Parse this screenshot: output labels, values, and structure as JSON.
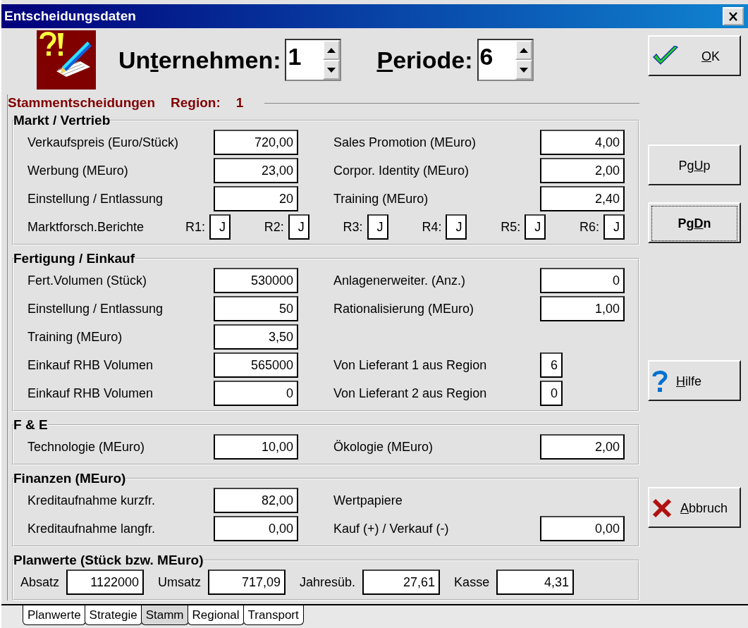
{
  "window": {
    "title": "Entscheidungsdaten"
  },
  "header": {
    "fields": [
      {
        "pre": "Un",
        "key": "t",
        "post": "ernehmen:",
        "value": "1"
      },
      {
        "key": "P",
        "post": "eriode:",
        "value": "6"
      }
    ]
  },
  "section": {
    "title": "Stammentscheidungen",
    "region_label": "Region:",
    "region": "1"
  },
  "groups": [
    {
      "title": "Markt / Vertrieb",
      "rows": [
        {
          "kind": "pair",
          "left": {
            "label": "Verkaufspreis (Euro/Stück)",
            "value": "720,00"
          },
          "right": {
            "label": "Sales Promotion (MEuro)",
            "value": "4,00"
          }
        },
        {
          "kind": "pair",
          "left": {
            "label": "Werbung (MEuro)",
            "value": "23,00"
          },
          "right": {
            "label": "Corpor. Identity (MEuro)",
            "value": "2,00"
          }
        },
        {
          "kind": "pair",
          "left": {
            "label": "Einstellung / Entlassung",
            "value": "20"
          },
          "right": {
            "label": "Training (MEuro)",
            "value": "2,40"
          }
        },
        {
          "kind": "reports",
          "label": "Marktforsch.Berichte",
          "items": [
            {
              "label": "R1:",
              "value": "J"
            },
            {
              "label": "R2:",
              "value": "J"
            },
            {
              "label": "R3:",
              "value": "J"
            },
            {
              "label": "R4:",
              "value": "J"
            },
            {
              "label": "R5:",
              "value": "J"
            },
            {
              "label": "R6:",
              "value": "J"
            }
          ]
        }
      ]
    },
    {
      "title": "Fertigung / Einkauf",
      "rows": [
        {
          "kind": "pair",
          "left": {
            "label": "Fert.Volumen (Stück)",
            "value": "530000"
          },
          "right": {
            "label": "Anlagenerweiter. (Anz.)",
            "value": "0"
          }
        },
        {
          "kind": "pair",
          "left": {
            "label": "Einstellung / Entlassung",
            "value": "50"
          },
          "right": {
            "label": "Rationalisierung (MEuro)",
            "value": "1,00"
          }
        },
        {
          "kind": "pair",
          "left": {
            "label": "Training  (MEuro)",
            "value": "3,50"
          }
        },
        {
          "kind": "pair",
          "left": {
            "label": "Einkauf  RHB Volumen",
            "value": "565000"
          },
          "right": {
            "label": "Von Lieferant 1 aus Region",
            "value": "6",
            "small": true
          }
        },
        {
          "kind": "pair",
          "left": {
            "label": "Einkauf  RHB Volumen",
            "value": "0"
          },
          "right": {
            "label": "Von Lieferant 2 aus Region",
            "value": "0",
            "small": true
          }
        }
      ]
    },
    {
      "title": "F & E",
      "rows": [
        {
          "kind": "pair",
          "left": {
            "label": "Technologie  (MEuro)",
            "value": "10,00"
          },
          "right": {
            "label": "Ökologie (MEuro)",
            "value": "2,00"
          }
        }
      ]
    },
    {
      "title": "Finanzen (MEuro)",
      "rows": [
        {
          "kind": "pair",
          "left": {
            "label": "Kreditaufnahme kurzfr.",
            "value": "82,00"
          },
          "right": {
            "label": "Wertpapiere"
          }
        },
        {
          "kind": "pair",
          "left": {
            "label": "Kreditaufnahme langfr.",
            "value": "0,00"
          },
          "right": {
            "label": "Kauf (+) / Verkauf (-)",
            "value": "0,00"
          }
        }
      ]
    }
  ],
  "plan": {
    "title": "Planwerte (Stück bzw. MEuro)",
    "items": [
      {
        "label": "Absatz",
        "value": "1122000"
      },
      {
        "label": "Umsatz",
        "value": "717,09"
      },
      {
        "label": "Jahresüb.",
        "value": "27,61"
      },
      {
        "label": "Kasse",
        "value": "4,31"
      }
    ]
  },
  "buttons": [
    {
      "kind": "ok",
      "key": "O",
      "post": "K",
      "focused": false
    },
    {
      "kind": "pgup",
      "pre": "Pg",
      "key": "U",
      "post": "p",
      "focused": false
    },
    {
      "kind": "pgdn",
      "pre": "Pg",
      "key": "D",
      "post": "n",
      "focused": true
    },
    {
      "kind": "help",
      "key": "H",
      "post": "ilfe",
      "focused": false
    },
    {
      "kind": "cancel",
      "key": "A",
      "post": "bbruch",
      "focused": false
    }
  ],
  "tabs": [
    {
      "label": "Planwerte",
      "selected": false
    },
    {
      "label": "Strategie",
      "selected": false
    },
    {
      "label": "Stamm",
      "selected": true
    },
    {
      "label": "Regional",
      "selected": false
    },
    {
      "label": "Transport",
      "selected": false
    }
  ]
}
